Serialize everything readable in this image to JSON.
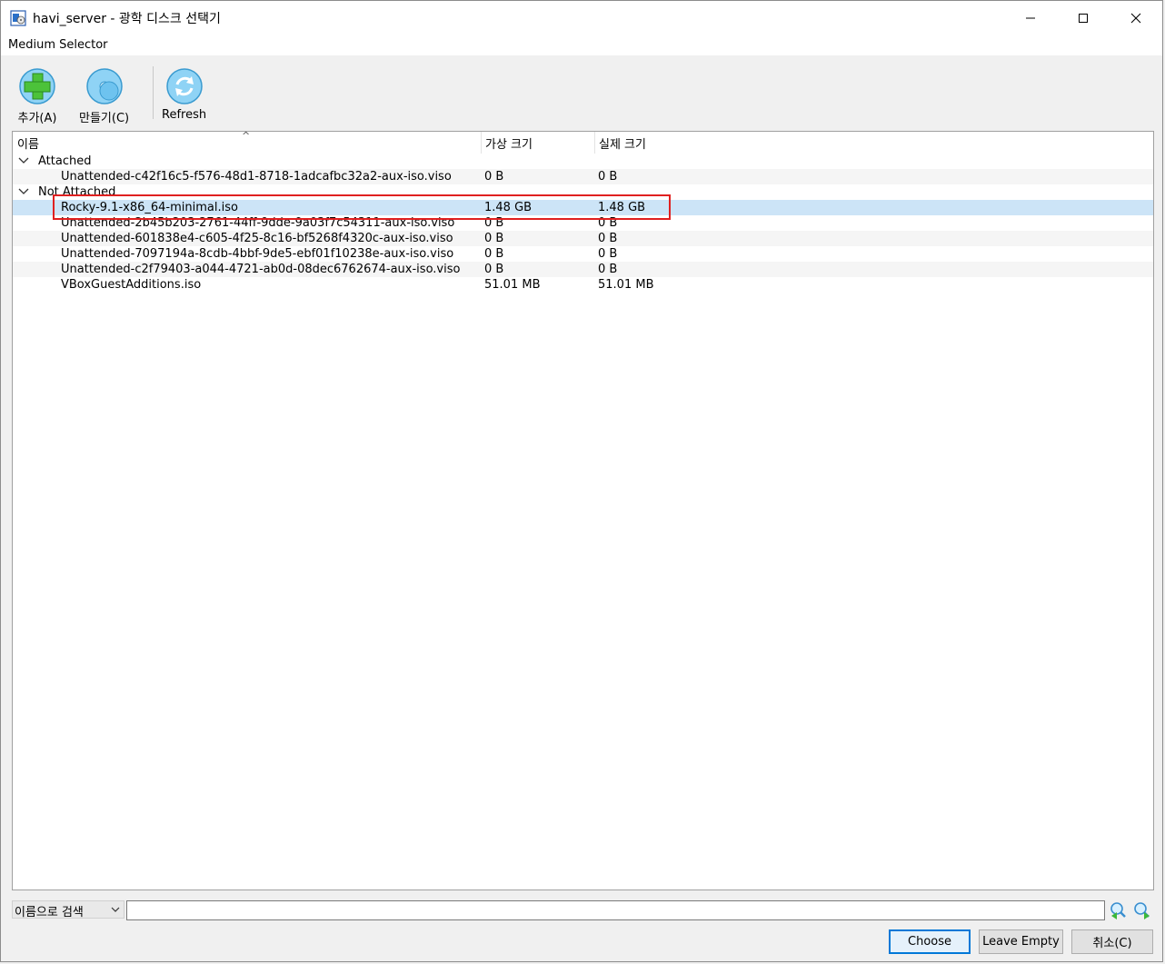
{
  "window": {
    "title": "havi_server - 광학 디스크 선택기"
  },
  "menu": {
    "label": "Medium Selector"
  },
  "toolbar": {
    "add_label": "추가(A)",
    "create_label": "만들기(C)",
    "refresh_label": "Refresh"
  },
  "table": {
    "columns": [
      "이름",
      "가상 크기",
      "실제 크기"
    ],
    "groups": [
      {
        "label": "Attached",
        "rows": [
          {
            "name": "Unattended-c42f16c5-f576-48d1-8718-1adcafbc32a2-aux-iso.viso",
            "virtual": "0 B",
            "real": "0 B"
          }
        ]
      },
      {
        "label": "Not Attached",
        "rows": [
          {
            "name": "Rocky-9.1-x86_64-minimal.iso",
            "virtual": "1.48 GB",
            "real": "1.48 GB",
            "selected": true
          },
          {
            "name": "Unattended-2b45b203-2761-44ff-9dde-9a03f7c54311-aux-iso.viso",
            "virtual": "0 B",
            "real": "0 B"
          },
          {
            "name": "Unattended-601838e4-c605-4f25-8c16-bf5268f4320c-aux-iso.viso",
            "virtual": "0 B",
            "real": "0 B"
          },
          {
            "name": "Unattended-7097194a-8cdb-4bbf-9de5-ebf01f10238e-aux-iso.viso",
            "virtual": "0 B",
            "real": "0 B"
          },
          {
            "name": "Unattended-c2f79403-a044-4721-ab0d-08dec6762674-aux-iso.viso",
            "virtual": "0 B",
            "real": "0 B"
          },
          {
            "name": "VBoxGuestAdditions.iso",
            "virtual": "51.01 MB",
            "real": "51.01 MB"
          }
        ]
      }
    ]
  },
  "search": {
    "mode_label": "이름으로 검색",
    "value": ""
  },
  "buttons": {
    "choose": "Choose",
    "leave_empty": "Leave Empty",
    "cancel": "취소(C)"
  },
  "colors": {
    "selection": "#cce4f7",
    "highlight_box": "#e02020",
    "default_button_border": "#0078d7"
  }
}
